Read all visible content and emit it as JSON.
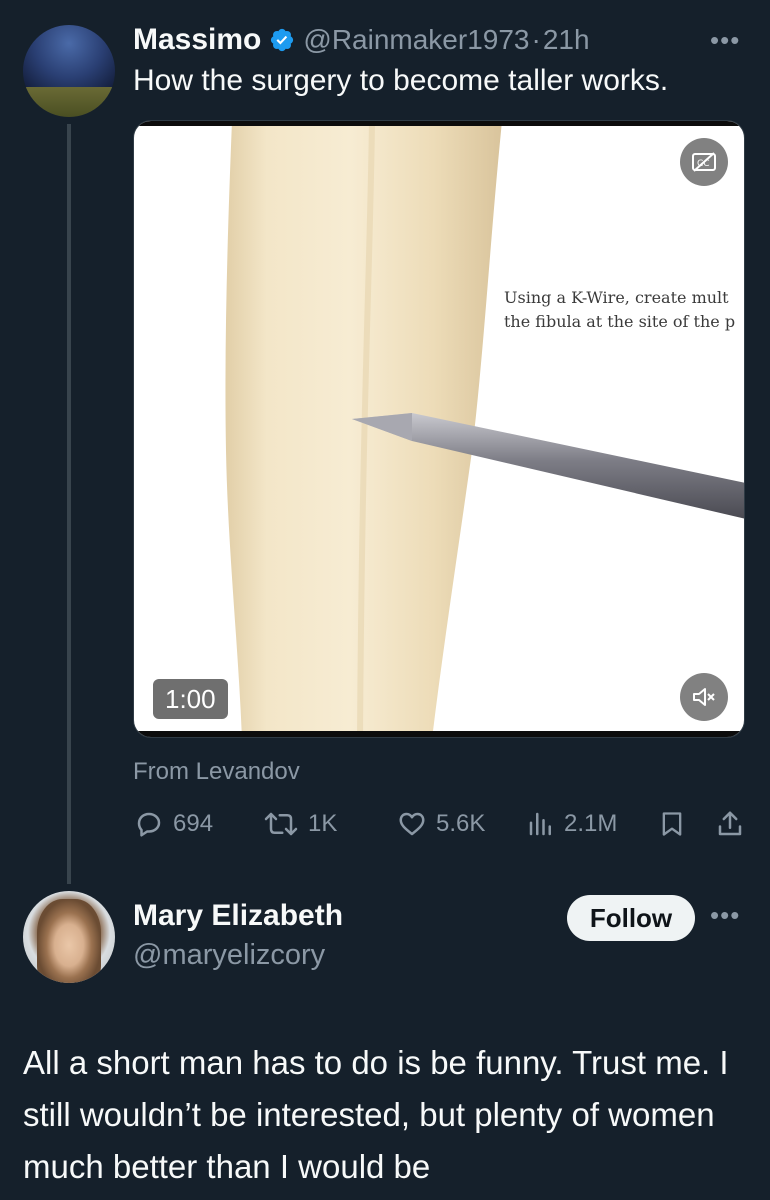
{
  "tweet": {
    "author_name": "Massimo",
    "handle": "@Rainmaker1973",
    "separator": "·",
    "time": "21h",
    "more": "•••",
    "text": "How the surgery to become taller works.",
    "media": {
      "caption_line1": "Using a K-Wire, create mult",
      "caption_line2": "the fibula at the site of the p",
      "duration": "1:00",
      "icons": [
        "captions-off-icon",
        "mute-icon"
      ]
    },
    "source": "From Levandov",
    "stats": {
      "replies": "694",
      "reposts": "1K",
      "likes": "5.6K",
      "views": "2.1M"
    }
  },
  "reply": {
    "author_name": "Mary Elizabeth",
    "handle": "@maryelizcory",
    "follow_label": "Follow",
    "more": "•••",
    "text": "All a short man has to do is be funny. Trust me. I still wouldn’t be interested, but plenty of women much better than I would be"
  },
  "colors": {
    "background": "#15202b",
    "text": "#f7f9f9",
    "muted": "#8b98a5",
    "verified": "#1d9bf0",
    "follow_bg": "#eff3f4"
  }
}
